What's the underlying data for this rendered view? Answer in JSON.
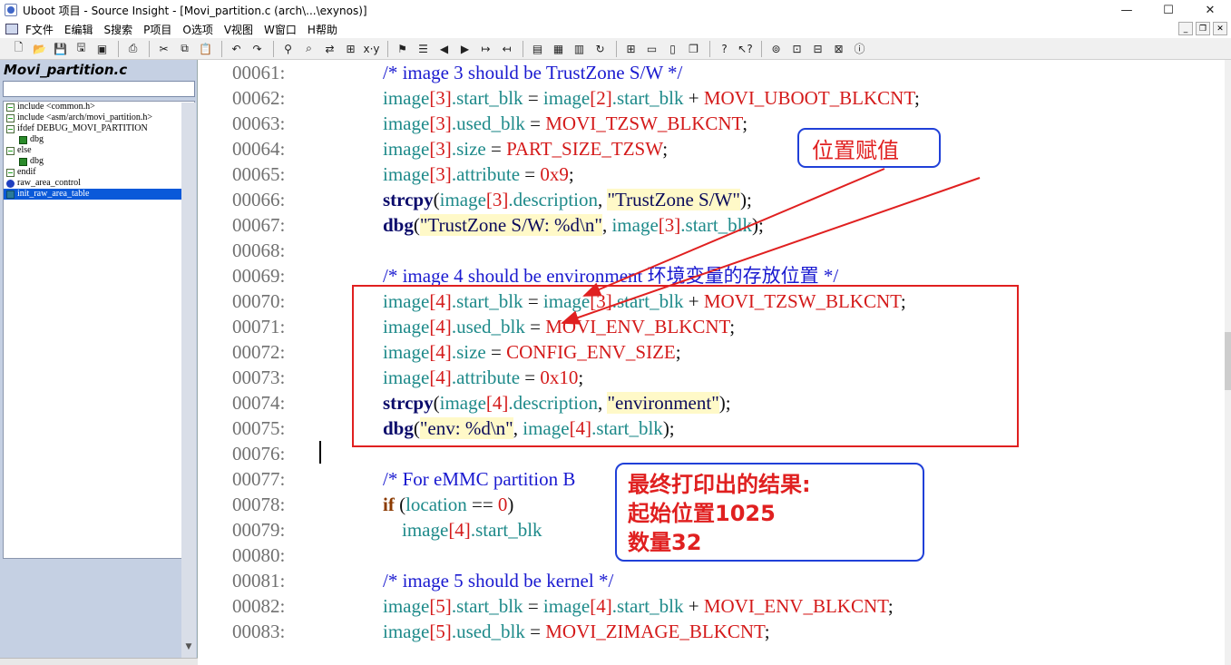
{
  "window": {
    "title": "Uboot 项目 - Source Insight - [Movi_partition.c (arch\\...\\exynos)]",
    "controls": {
      "minimize": "—",
      "maximize": "☐",
      "close": "✕"
    }
  },
  "menu": {
    "items": [
      "F文件",
      "E编辑",
      "S搜索",
      "P项目",
      "O选项",
      "V视图",
      "W窗口",
      "H帮助"
    ],
    "mdi": {
      "minimize": "_",
      "restore": "❐",
      "close": "✕"
    }
  },
  "toolbar": {
    "groups": [
      [
        "new-icon",
        "open-icon",
        "save-icon",
        "save-as-icon",
        "save-all-icon"
      ],
      [
        "print-icon"
      ],
      [
        "cut-icon",
        "copy-icon",
        "paste-icon"
      ],
      [
        "undo-icon",
        "redo-icon"
      ],
      [
        "lookup-icon",
        "search-files-icon",
        "replace-icon",
        "browse-icon",
        "xref-icon"
      ],
      [
        "bookmark-icon",
        "bookmark-list-icon",
        "back-icon",
        "forward-icon",
        "jump-icon",
        "jump-back-icon"
      ],
      [
        "symbol-window-icon",
        "context-icon",
        "relation-icon",
        "sync-icon"
      ],
      [
        "tile-icon",
        "split-horizontal-icon",
        "split-vertical-icon",
        "cascade-icon"
      ],
      [
        "help-icon",
        "whats-this-icon"
      ],
      [
        "project-icon",
        "browse-project-icon",
        "relation-window-icon",
        "graph-icon",
        "about-icon"
      ]
    ],
    "glyphs": {
      "new-icon": "🗋",
      "open-icon": "📂",
      "save-icon": "💾",
      "save-as-icon": "🖫",
      "save-all-icon": "▣",
      "print-icon": "⎙",
      "cut-icon": "✂",
      "copy-icon": "⧉",
      "paste-icon": "📋",
      "undo-icon": "↶",
      "redo-icon": "↷",
      "lookup-icon": "⚲",
      "search-files-icon": "⌕",
      "replace-icon": "⇄",
      "browse-icon": "⊞",
      "xref-icon": "x·y",
      "bookmark-icon": "⚑",
      "bookmark-list-icon": "☰",
      "back-icon": "◀",
      "forward-icon": "▶",
      "jump-icon": "↦",
      "jump-back-icon": "↤",
      "symbol-window-icon": "▤",
      "context-icon": "▦",
      "relation-icon": "▥",
      "sync-icon": "↻",
      "tile-icon": "⊞",
      "split-horizontal-icon": "▭",
      "split-vertical-icon": "▯",
      "cascade-icon": "❐",
      "help-icon": "?",
      "whats-this-icon": "↖?",
      "project-icon": "⊚",
      "browse-project-icon": "⊡",
      "relation-window-icon": "⊟",
      "graph-icon": "⊠",
      "about-icon": "ⓘ"
    }
  },
  "symbols": {
    "file_title": "Movi_partition.c",
    "search_value": "",
    "items": [
      {
        "label": "include <common.h>",
        "icon": "include-icon",
        "indent": 0,
        "selected": false
      },
      {
        "label": "include <asm/arch/movi_partition.h>",
        "icon": "include-icon",
        "indent": 0,
        "selected": false
      },
      {
        "label": "ifdef DEBUG_MOVI_PARTITION",
        "icon": "include-icon",
        "indent": 0,
        "selected": false
      },
      {
        "label": "dbg",
        "icon": "macro-icon",
        "indent": 1,
        "selected": false
      },
      {
        "label": "else",
        "icon": "include-icon",
        "indent": 0,
        "selected": false
      },
      {
        "label": "dbg",
        "icon": "macro-icon",
        "indent": 1,
        "selected": false
      },
      {
        "label": "endif",
        "icon": "include-icon",
        "indent": 0,
        "selected": false
      },
      {
        "label": "raw_area_control",
        "icon": "variable-icon",
        "indent": 0,
        "selected": false
      },
      {
        "label": "init_raw_area_table",
        "icon": "function-icon",
        "indent": 0,
        "selected": true
      }
    ]
  },
  "code": {
    "lines": [
      {
        "num": "00061:",
        "tokens": [
          [
            "",
            "    "
          ],
          [
            "cm",
            "/* image 3 should be TrustZone S/W */"
          ]
        ]
      },
      {
        "num": "00062:",
        "tokens": [
          [
            "",
            "    "
          ],
          [
            "id",
            "image"
          ],
          [
            "mac",
            "[3]"
          ],
          [
            "id",
            ".start_blk"
          ],
          [
            "op",
            " = "
          ],
          [
            "id",
            "image"
          ],
          [
            "mac",
            "[2]"
          ],
          [
            "id",
            ".start_blk"
          ],
          [
            "op",
            " + "
          ],
          [
            "mac",
            "MOVI_UBOOT_BLKCNT"
          ],
          [
            "op",
            ";"
          ]
        ]
      },
      {
        "num": "00063:",
        "tokens": [
          [
            "",
            "    "
          ],
          [
            "id",
            "image"
          ],
          [
            "mac",
            "[3]"
          ],
          [
            "id",
            ".used_blk"
          ],
          [
            "op",
            " = "
          ],
          [
            "mac",
            "MOVI_TZSW_BLKCNT"
          ],
          [
            "op",
            ";"
          ]
        ]
      },
      {
        "num": "00064:",
        "tokens": [
          [
            "",
            "    "
          ],
          [
            "id",
            "image"
          ],
          [
            "mac",
            "[3]"
          ],
          [
            "id",
            ".size"
          ],
          [
            "op",
            " = "
          ],
          [
            "mac",
            "PART_SIZE_TZSW"
          ],
          [
            "op",
            ";"
          ]
        ]
      },
      {
        "num": "00065:",
        "tokens": [
          [
            "",
            "    "
          ],
          [
            "id",
            "image"
          ],
          [
            "mac",
            "[3]"
          ],
          [
            "id",
            ".attribute"
          ],
          [
            "op",
            " = "
          ],
          [
            "mac",
            "0x9"
          ],
          [
            "op",
            ";"
          ]
        ]
      },
      {
        "num": "00066:",
        "tokens": [
          [
            "",
            "    "
          ],
          [
            "fn",
            "strcpy"
          ],
          [
            "op",
            "("
          ],
          [
            "id",
            "image"
          ],
          [
            "mac",
            "[3]"
          ],
          [
            "id",
            ".description"
          ],
          [
            "op",
            ", "
          ],
          [
            "str",
            "\"TrustZone S/W\""
          ],
          [
            "op",
            ");"
          ]
        ]
      },
      {
        "num": "00067:",
        "tokens": [
          [
            "",
            "    "
          ],
          [
            "fn",
            "dbg"
          ],
          [
            "op",
            "("
          ],
          [
            "str",
            "\"TrustZone S/W: %d\\n\""
          ],
          [
            "op",
            ", "
          ],
          [
            "id",
            "image"
          ],
          [
            "mac",
            "[3]"
          ],
          [
            "id",
            ".start_blk"
          ],
          [
            "op",
            ");"
          ]
        ]
      },
      {
        "num": "00068:",
        "tokens": []
      },
      {
        "num": "00069:",
        "tokens": [
          [
            "",
            "    "
          ],
          [
            "cm",
            "/* image 4 should be environment 环境变量的存放位置 */"
          ]
        ]
      },
      {
        "num": "00070:",
        "tokens": [
          [
            "",
            "    "
          ],
          [
            "id",
            "image"
          ],
          [
            "mac",
            "[4]"
          ],
          [
            "id",
            ".start_blk"
          ],
          [
            "op",
            " = "
          ],
          [
            "id",
            "image"
          ],
          [
            "mac",
            "[3]"
          ],
          [
            "id",
            ".start_blk"
          ],
          [
            "op",
            " + "
          ],
          [
            "mac",
            "MOVI_TZSW_BLKCNT"
          ],
          [
            "op",
            ";"
          ]
        ]
      },
      {
        "num": "00071:",
        "tokens": [
          [
            "",
            "    "
          ],
          [
            "id",
            "image"
          ],
          [
            "mac",
            "[4]"
          ],
          [
            "id",
            ".used_blk"
          ],
          [
            "op",
            " = "
          ],
          [
            "mac",
            "MOVI_ENV_BLKCNT"
          ],
          [
            "op",
            ";"
          ]
        ]
      },
      {
        "num": "00072:",
        "tokens": [
          [
            "",
            "    "
          ],
          [
            "id",
            "image"
          ],
          [
            "mac",
            "[4]"
          ],
          [
            "id",
            ".size"
          ],
          [
            "op",
            " = "
          ],
          [
            "mac",
            "CONFIG_ENV_SIZE"
          ],
          [
            "op",
            ";"
          ]
        ]
      },
      {
        "num": "00073:",
        "tokens": [
          [
            "",
            "    "
          ],
          [
            "id",
            "image"
          ],
          [
            "mac",
            "[4]"
          ],
          [
            "id",
            ".attribute"
          ],
          [
            "op",
            " = "
          ],
          [
            "mac",
            "0x10"
          ],
          [
            "op",
            ";"
          ]
        ]
      },
      {
        "num": "00074:",
        "tokens": [
          [
            "",
            "    "
          ],
          [
            "fn",
            "strcpy"
          ],
          [
            "op",
            "("
          ],
          [
            "id",
            "image"
          ],
          [
            "mac",
            "[4]"
          ],
          [
            "id",
            ".description"
          ],
          [
            "op",
            ", "
          ],
          [
            "str",
            "\"environment\""
          ],
          [
            "op",
            ");"
          ]
        ]
      },
      {
        "num": "00075:",
        "tokens": [
          [
            "",
            "    "
          ],
          [
            "fn",
            "dbg"
          ],
          [
            "op",
            "("
          ],
          [
            "str",
            "\"env: %d\\n\""
          ],
          [
            "op",
            ", "
          ],
          [
            "id",
            "image"
          ],
          [
            "mac",
            "[4]"
          ],
          [
            "id",
            ".start_blk"
          ],
          [
            "op",
            ");"
          ]
        ]
      },
      {
        "num": "00076:",
        "tokens": []
      },
      {
        "num": "00077:",
        "tokens": [
          [
            "",
            "    "
          ],
          [
            "cm",
            "/* For eMMC partition B"
          ]
        ]
      },
      {
        "num": "00078:",
        "tokens": [
          [
            "",
            "    "
          ],
          [
            "kw",
            "if"
          ],
          [
            "op",
            " ("
          ],
          [
            "id",
            "location"
          ],
          [
            "op",
            " == "
          ],
          [
            "mac",
            "0"
          ],
          [
            "op",
            ")"
          ]
        ]
      },
      {
        "num": "00079:",
        "tokens": [
          [
            "",
            "        "
          ],
          [
            "id",
            "image"
          ],
          [
            "mac",
            "[4]"
          ],
          [
            "id",
            ".start_blk"
          ]
        ]
      },
      {
        "num": "00080:",
        "tokens": []
      },
      {
        "num": "00081:",
        "tokens": [
          [
            "",
            "    "
          ],
          [
            "cm",
            "/* image 5 should be kernel */"
          ]
        ]
      },
      {
        "num": "00082:",
        "tokens": [
          [
            "",
            "    "
          ],
          [
            "id",
            "image"
          ],
          [
            "mac",
            "[5]"
          ],
          [
            "id",
            ".start_blk"
          ],
          [
            "op",
            " = "
          ],
          [
            "id",
            "image"
          ],
          [
            "mac",
            "[4]"
          ],
          [
            "id",
            ".start_blk"
          ],
          [
            "op",
            " + "
          ],
          [
            "mac",
            "MOVI_ENV_BLKCNT"
          ],
          [
            "op",
            ";"
          ]
        ]
      },
      {
        "num": "00083:",
        "tokens": [
          [
            "",
            "    "
          ],
          [
            "id",
            "image"
          ],
          [
            "mac",
            "[5]"
          ],
          [
            "id",
            ".used_blk"
          ],
          [
            "op",
            " = "
          ],
          [
            "mac",
            "MOVI_ZIMAGE_BLKCNT"
          ],
          [
            "op",
            ";"
          ]
        ]
      }
    ]
  },
  "annotations": {
    "callout_assign": "位置赋值",
    "callout_result_title": "最终打印出的结果:",
    "callout_result_start": "起始位置1025",
    "callout_result_count": "数量32",
    "colors": {
      "box": "#e02020",
      "callout_border": "#2040d8",
      "text": "#e02020"
    }
  }
}
